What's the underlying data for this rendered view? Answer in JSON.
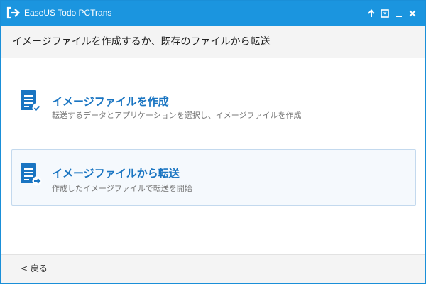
{
  "window": {
    "title": "EaseUS Todo PCTrans"
  },
  "header": {
    "title": "イメージファイルを作成するか、既存のファイルから転送"
  },
  "options": [
    {
      "title": "イメージファイルを作成",
      "description": "転送するデータとアプリケーションを選択し、イメージファイルを作成"
    },
    {
      "title": "イメージファイルから転送",
      "description": "作成したイメージファイルで転送を開始",
      "selected": true
    }
  ],
  "footer": {
    "back_label": "< 戻る"
  },
  "icons": {
    "app_logo": "pctrans-logo-icon",
    "upload": "upload-arrow-icon",
    "menu": "menu-box-icon",
    "minimize": "minimize-icon",
    "close": "close-icon",
    "create_image": "document-check-icon",
    "transfer_image": "document-arrow-icon"
  },
  "colors": {
    "titlebar": "#1b95df",
    "accent": "#1a75c2",
    "selected_border": "#c3d9ee",
    "selected_bg": "#f5f9fd"
  }
}
